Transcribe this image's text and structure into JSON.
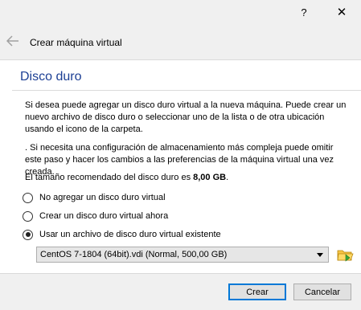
{
  "window": {
    "help_label": "?",
    "close_label": "✕"
  },
  "wizard": {
    "title": "Crear máquina virtual",
    "page_title": "Disco duro"
  },
  "content": {
    "paragraph1": "Si desea puede agregar un disco duro virtual a la nueva máquina. Puede crear un nuevo archivo de disco duro o seleccionar uno de la lista o de otra ubicación usando el icono de la carpeta.",
    "paragraph2": ". Si necesita una configuración de almacenamiento más compleja puede omitir este paso y hacer los cambios a las preferencias de la máquina virtual una vez creada.",
    "recommended_prefix": "El tamaño recomendado del disco duro es ",
    "recommended_size": "8,00 GB",
    "recommended_suffix": "."
  },
  "options": [
    {
      "label": "No agregar un disco duro virtual",
      "checked": false
    },
    {
      "label": "Crear un disco duro virtual ahora",
      "checked": false
    },
    {
      "label": "Usar un archivo de disco duro virtual existente",
      "checked": true
    }
  ],
  "disk_select": {
    "value": "CentOS 7-1804 (64bit).vdi (Normal, 500,00 GB)"
  },
  "icons": {
    "back": "back-arrow-icon",
    "folder": "folder-open-icon"
  },
  "buttons": {
    "create": "Crear",
    "cancel": "Cancelar"
  },
  "colors": {
    "page_title": "#1c3f94",
    "folder_yellow": "#f6c445",
    "folder_green": "#3aa53a",
    "default_button_border": "#0078d7"
  }
}
